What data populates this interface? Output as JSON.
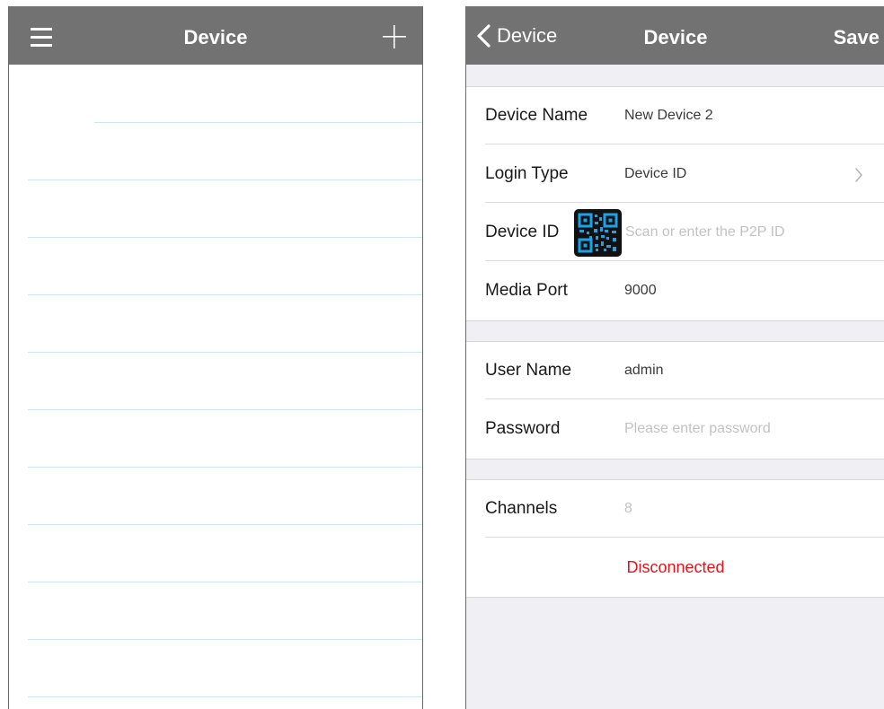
{
  "left_screen": {
    "title": "Device",
    "icons": {
      "menu": "hamburger-menu-icon",
      "add": "plus-icon"
    },
    "list_rows": 11
  },
  "right_screen": {
    "title": "Device",
    "back_label": "Device",
    "save_label": "Save",
    "form": {
      "device_name": {
        "label": "Device Name",
        "value": "New Device 2"
      },
      "login_type": {
        "label": "Login Type",
        "value": "Device ID"
      },
      "device_id": {
        "label": "Device ID",
        "placeholder": "Scan or enter the P2P ID"
      },
      "media_port": {
        "label": "Media Port",
        "value": "9000"
      },
      "user_name": {
        "label": "User Name",
        "value": "admin"
      },
      "password": {
        "label": "Password",
        "placeholder": "Please enter password"
      },
      "channels": {
        "label": "Channels",
        "value": "8"
      },
      "status": "Disconnected"
    },
    "icons": {
      "back": "chevron-left-icon",
      "login_type": "chevron-right-icon",
      "scan": "qr-code-icon"
    }
  },
  "colors": {
    "navbar": "#727272",
    "background": "#efeff4",
    "status": "#e8121b",
    "qr_accent": "#1aa3e8",
    "divider_blue": "#cfe3f2"
  }
}
